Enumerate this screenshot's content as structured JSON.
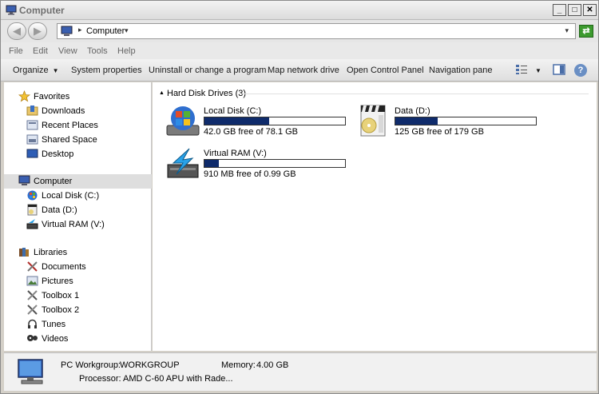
{
  "window": {
    "title": "Computer",
    "controls": {
      "minimize": "_",
      "maximize": "□",
      "close": "✕"
    }
  },
  "address": {
    "path": "Computer",
    "separator": "▸",
    "dropdown": "▾"
  },
  "menu": [
    "File",
    "Edit",
    "View",
    "Tools",
    "Help"
  ],
  "commands": {
    "organize": "Organize",
    "system_properties": "System properties",
    "uninstall": "Uninstall or change a program",
    "map_network": "Map network drive",
    "control_panel": "Open Control Panel",
    "navigation_pane": "Navigation pane",
    "help": "?"
  },
  "nav": {
    "favorites": {
      "label": "Favorites",
      "items": [
        "Downloads",
        "Recent Places",
        "Shared Space",
        "Desktop"
      ]
    },
    "computer": {
      "label": "Computer",
      "items": [
        "Local Disk (C:)",
        "Data (D:)",
        "Virtual RAM (V:)"
      ]
    },
    "libraries": {
      "label": "Libraries",
      "items": [
        "Documents",
        "Pictures",
        "Toolbox 1",
        "Toolbox 2",
        "Tunes",
        "Videos"
      ]
    }
  },
  "content": {
    "group": "Hard Disk Drives (3)",
    "drives": [
      {
        "name": "Local Disk (C:)",
        "free": "42.0 GB free of 78.1 GB",
        "used_fraction": 0.46
      },
      {
        "name": "Data (D:)",
        "free": "125 GB free of 179 GB",
        "used_fraction": 0.3
      },
      {
        "name": "Virtual RAM (V:)",
        "free": "910 MB free of 0.99 GB",
        "used_fraction": 0.1
      }
    ]
  },
  "details": {
    "workgroup_label": "PC  Workgroup:",
    "workgroup_value": "WORKGROUP",
    "memory_label": "Memory:",
    "memory_value": "4.00 GB",
    "processor_label": "Processor:",
    "processor_value": "AMD C-60 APU with Rade..."
  },
  "colors": {
    "bar_fill": "#0f2b6b",
    "selection": "#dedede",
    "refresh_green": "#3c9a2e"
  }
}
